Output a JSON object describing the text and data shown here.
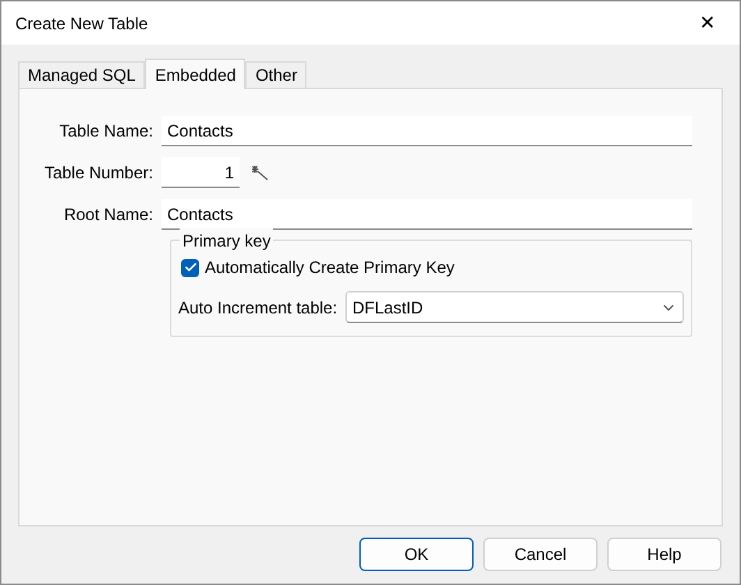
{
  "window": {
    "title": "Create New Table",
    "close": "✕"
  },
  "tabs": [
    {
      "label": "Managed SQL",
      "selected": false
    },
    {
      "label": "Embedded",
      "selected": true
    },
    {
      "label": "Other",
      "selected": false
    }
  ],
  "fields": [
    {
      "label": "Table Name:",
      "value": "Contacts",
      "kind": "text"
    },
    {
      "label": "Table Number:",
      "value": "1",
      "kind": "number"
    },
    {
      "label": "Root Name:",
      "value": "Contacts",
      "kind": "text"
    }
  ],
  "primary_key": {
    "title": "Primary key",
    "checkbox": {
      "label": "Automatically Create Primary Key",
      "checked": true
    },
    "auto_increment": {
      "label": "Auto Increment table:",
      "value": "DFLastID"
    }
  },
  "buttons": [
    {
      "label": "OK",
      "default": true
    },
    {
      "label": "Cancel",
      "default": false
    },
    {
      "label": "Help",
      "default": false
    }
  ]
}
